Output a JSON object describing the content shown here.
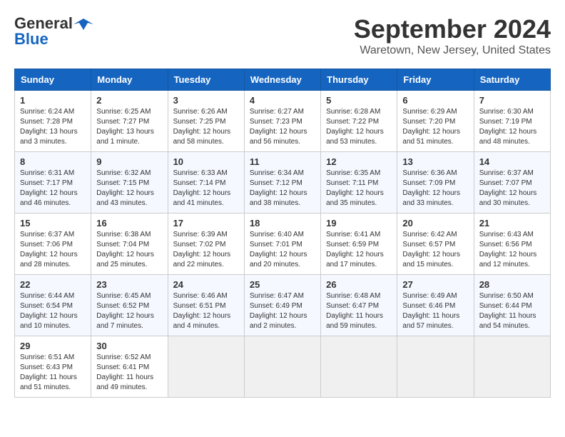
{
  "header": {
    "logo_general": "General",
    "logo_blue": "Blue",
    "month_year": "September 2024",
    "location": "Waretown, New Jersey, United States"
  },
  "weekdays": [
    "Sunday",
    "Monday",
    "Tuesday",
    "Wednesday",
    "Thursday",
    "Friday",
    "Saturday"
  ],
  "weeks": [
    [
      {
        "day": "1",
        "sunrise": "Sunrise: 6:24 AM",
        "sunset": "Sunset: 7:28 PM",
        "daylight": "Daylight: 13 hours and 3 minutes."
      },
      {
        "day": "2",
        "sunrise": "Sunrise: 6:25 AM",
        "sunset": "Sunset: 7:27 PM",
        "daylight": "Daylight: 13 hours and 1 minute."
      },
      {
        "day": "3",
        "sunrise": "Sunrise: 6:26 AM",
        "sunset": "Sunset: 7:25 PM",
        "daylight": "Daylight: 12 hours and 58 minutes."
      },
      {
        "day": "4",
        "sunrise": "Sunrise: 6:27 AM",
        "sunset": "Sunset: 7:23 PM",
        "daylight": "Daylight: 12 hours and 56 minutes."
      },
      {
        "day": "5",
        "sunrise": "Sunrise: 6:28 AM",
        "sunset": "Sunset: 7:22 PM",
        "daylight": "Daylight: 12 hours and 53 minutes."
      },
      {
        "day": "6",
        "sunrise": "Sunrise: 6:29 AM",
        "sunset": "Sunset: 7:20 PM",
        "daylight": "Daylight: 12 hours and 51 minutes."
      },
      {
        "day": "7",
        "sunrise": "Sunrise: 6:30 AM",
        "sunset": "Sunset: 7:19 PM",
        "daylight": "Daylight: 12 hours and 48 minutes."
      }
    ],
    [
      {
        "day": "8",
        "sunrise": "Sunrise: 6:31 AM",
        "sunset": "Sunset: 7:17 PM",
        "daylight": "Daylight: 12 hours and 46 minutes."
      },
      {
        "day": "9",
        "sunrise": "Sunrise: 6:32 AM",
        "sunset": "Sunset: 7:15 PM",
        "daylight": "Daylight: 12 hours and 43 minutes."
      },
      {
        "day": "10",
        "sunrise": "Sunrise: 6:33 AM",
        "sunset": "Sunset: 7:14 PM",
        "daylight": "Daylight: 12 hours and 41 minutes."
      },
      {
        "day": "11",
        "sunrise": "Sunrise: 6:34 AM",
        "sunset": "Sunset: 7:12 PM",
        "daylight": "Daylight: 12 hours and 38 minutes."
      },
      {
        "day": "12",
        "sunrise": "Sunrise: 6:35 AM",
        "sunset": "Sunset: 7:11 PM",
        "daylight": "Daylight: 12 hours and 35 minutes."
      },
      {
        "day": "13",
        "sunrise": "Sunrise: 6:36 AM",
        "sunset": "Sunset: 7:09 PM",
        "daylight": "Daylight: 12 hours and 33 minutes."
      },
      {
        "day": "14",
        "sunrise": "Sunrise: 6:37 AM",
        "sunset": "Sunset: 7:07 PM",
        "daylight": "Daylight: 12 hours and 30 minutes."
      }
    ],
    [
      {
        "day": "15",
        "sunrise": "Sunrise: 6:37 AM",
        "sunset": "Sunset: 7:06 PM",
        "daylight": "Daylight: 12 hours and 28 minutes."
      },
      {
        "day": "16",
        "sunrise": "Sunrise: 6:38 AM",
        "sunset": "Sunset: 7:04 PM",
        "daylight": "Daylight: 12 hours and 25 minutes."
      },
      {
        "day": "17",
        "sunrise": "Sunrise: 6:39 AM",
        "sunset": "Sunset: 7:02 PM",
        "daylight": "Daylight: 12 hours and 22 minutes."
      },
      {
        "day": "18",
        "sunrise": "Sunrise: 6:40 AM",
        "sunset": "Sunset: 7:01 PM",
        "daylight": "Daylight: 12 hours and 20 minutes."
      },
      {
        "day": "19",
        "sunrise": "Sunrise: 6:41 AM",
        "sunset": "Sunset: 6:59 PM",
        "daylight": "Daylight: 12 hours and 17 minutes."
      },
      {
        "day": "20",
        "sunrise": "Sunrise: 6:42 AM",
        "sunset": "Sunset: 6:57 PM",
        "daylight": "Daylight: 12 hours and 15 minutes."
      },
      {
        "day": "21",
        "sunrise": "Sunrise: 6:43 AM",
        "sunset": "Sunset: 6:56 PM",
        "daylight": "Daylight: 12 hours and 12 minutes."
      }
    ],
    [
      {
        "day": "22",
        "sunrise": "Sunrise: 6:44 AM",
        "sunset": "Sunset: 6:54 PM",
        "daylight": "Daylight: 12 hours and 10 minutes."
      },
      {
        "day": "23",
        "sunrise": "Sunrise: 6:45 AM",
        "sunset": "Sunset: 6:52 PM",
        "daylight": "Daylight: 12 hours and 7 minutes."
      },
      {
        "day": "24",
        "sunrise": "Sunrise: 6:46 AM",
        "sunset": "Sunset: 6:51 PM",
        "daylight": "Daylight: 12 hours and 4 minutes."
      },
      {
        "day": "25",
        "sunrise": "Sunrise: 6:47 AM",
        "sunset": "Sunset: 6:49 PM",
        "daylight": "Daylight: 12 hours and 2 minutes."
      },
      {
        "day": "26",
        "sunrise": "Sunrise: 6:48 AM",
        "sunset": "Sunset: 6:47 PM",
        "daylight": "Daylight: 11 hours and 59 minutes."
      },
      {
        "day": "27",
        "sunrise": "Sunrise: 6:49 AM",
        "sunset": "Sunset: 6:46 PM",
        "daylight": "Daylight: 11 hours and 57 minutes."
      },
      {
        "day": "28",
        "sunrise": "Sunrise: 6:50 AM",
        "sunset": "Sunset: 6:44 PM",
        "daylight": "Daylight: 11 hours and 54 minutes."
      }
    ],
    [
      {
        "day": "29",
        "sunrise": "Sunrise: 6:51 AM",
        "sunset": "Sunset: 6:43 PM",
        "daylight": "Daylight: 11 hours and 51 minutes."
      },
      {
        "day": "30",
        "sunrise": "Sunrise: 6:52 AM",
        "sunset": "Sunset: 6:41 PM",
        "daylight": "Daylight: 11 hours and 49 minutes."
      },
      null,
      null,
      null,
      null,
      null
    ]
  ]
}
